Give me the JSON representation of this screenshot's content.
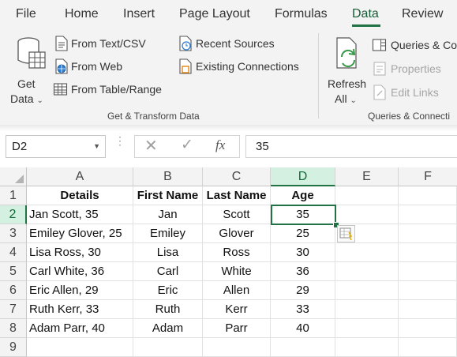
{
  "tabs": [
    "File",
    "Home",
    "Insert",
    "Page Layout",
    "Formulas",
    "Data",
    "Review"
  ],
  "active_tab": "Data",
  "ribbon": {
    "get_data_line1": "Get",
    "get_data_line2": "Data",
    "from_text_csv": "From Text/CSV",
    "from_web": "From Web",
    "from_table_range": "From Table/Range",
    "recent_sources": "Recent Sources",
    "existing_connections": "Existing Connections",
    "group_get_transform": "Get & Transform Data",
    "refresh_line1": "Refresh",
    "refresh_line2": "All",
    "queries_connections": "Queries & Co",
    "properties": "Properties",
    "edit_links": "Edit Links",
    "group_queries": "Queries & Connecti"
  },
  "formula_bar": {
    "name_box": "D2",
    "fx": "fx",
    "formula": "35"
  },
  "sheet": {
    "columns": [
      "A",
      "B",
      "C",
      "D",
      "E",
      "F"
    ],
    "rows": [
      {
        "num": "1",
        "cells": [
          "Details",
          "First Name",
          "Last Name",
          "Age",
          "",
          ""
        ]
      },
      {
        "num": "2",
        "cells": [
          "Jan Scott, 35",
          "Jan",
          "Scott",
          "35",
          "",
          ""
        ]
      },
      {
        "num": "3",
        "cells": [
          "Emiley Glover, 25",
          "Emiley",
          "Glover",
          "25",
          "",
          ""
        ]
      },
      {
        "num": "4",
        "cells": [
          "Lisa Ross, 30",
          "Lisa",
          "Ross",
          "30",
          "",
          ""
        ]
      },
      {
        "num": "5",
        "cells": [
          "Carl White, 36",
          "Carl",
          "White",
          "36",
          "",
          ""
        ]
      },
      {
        "num": "6",
        "cells": [
          "Eric Allen, 29",
          "Eric",
          "Allen",
          "29",
          "",
          ""
        ]
      },
      {
        "num": "7",
        "cells": [
          "Ruth Kerr, 33",
          "Ruth",
          "Kerr",
          "33",
          "",
          ""
        ]
      },
      {
        "num": "8",
        "cells": [
          "Adam Parr, 40",
          "Adam",
          "Parr",
          "40",
          "",
          ""
        ]
      },
      {
        "num": "9",
        "cells": [
          "",
          "",
          "",
          "",
          "",
          ""
        ]
      }
    ],
    "selected_cell": "D2"
  },
  "colors": {
    "accent": "#217346",
    "selected_header_bg": "#d3f0e0"
  }
}
